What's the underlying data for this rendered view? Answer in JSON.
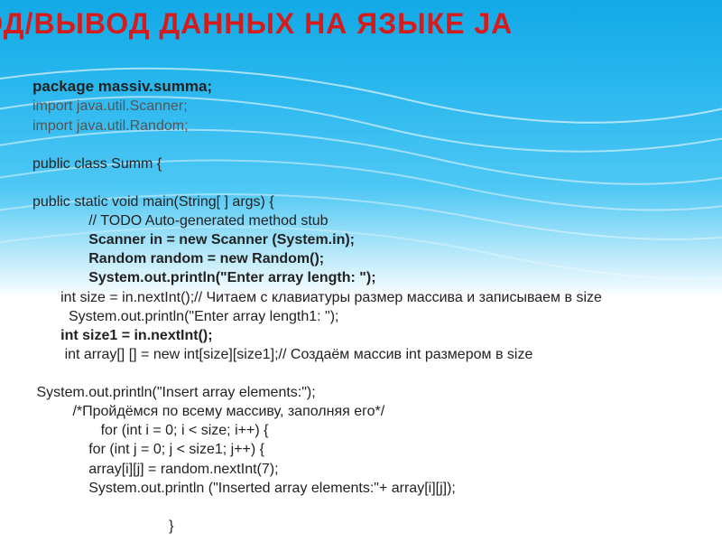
{
  "title": "ВОД/ВЫВОД ДАННЫХ НА ЯЗЫКЕ JA",
  "code": {
    "l1": "package massiv.summa;",
    "l2": "import java.util.Scanner;",
    "l3": "import java.util.Random;",
    "l4": "",
    "l5": "public class Summ {",
    "l6": "",
    "l7": "public static void main(String[ ] args) {",
    "l8": "              // TODO Auto-generated method stub",
    "l9": "              Scanner in = new Scanner (System.in);",
    "l10": "              Random random = new Random();",
    "l11": "              System.out.println(\"Enter array length: \");",
    "l12": "       int size = in.nextInt();// Читаем с клавиатуры размер массива и записываем в size",
    "l13": "         System.out.println(\"Enter array length1: \");",
    "l14": "       int size1 = in.nextInt();",
    "l15": "        int array[] [] = new int[size][size1];// Создаём массив int размером в size",
    "l16": "",
    "l17": " System.out.println(\"Insert array elements:\");",
    "l18": "          /*Пройдёмся по всему массиву, заполняя его*/",
    "l19": "                 for (int i = 0; i < size; i++) {",
    "l20": "              for (int j = 0; j < size1; j++) {",
    "l21": "              array[i][j] = random.nextInt(7);",
    "l22": "              System.out.println (\"Inserted array elements:\"+ array[i][j]);",
    "l23": "",
    "l24": "                                  }"
  }
}
